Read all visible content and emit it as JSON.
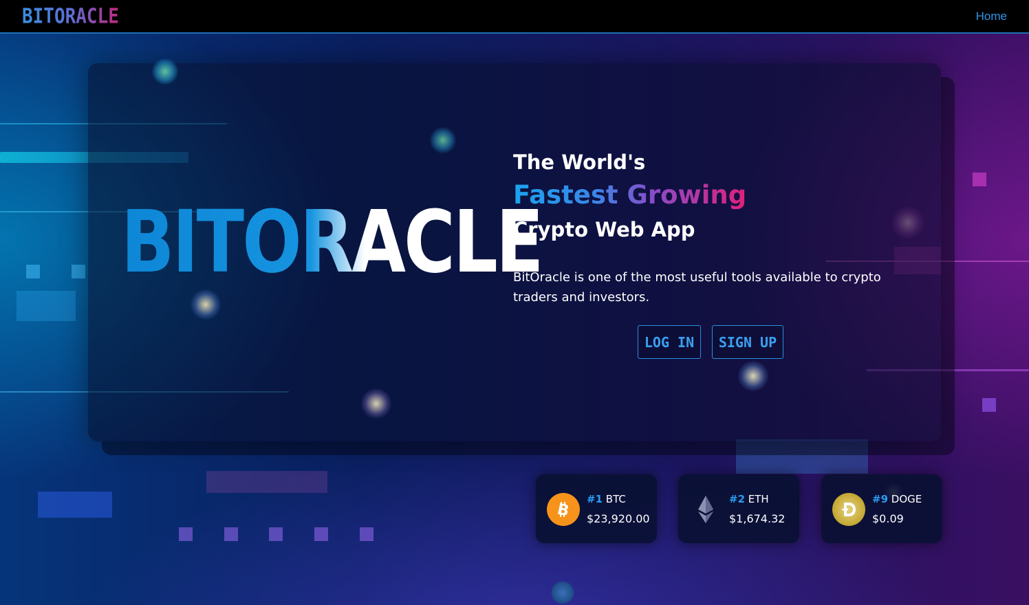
{
  "navbar": {
    "logo": "BITORACLE",
    "home_link": "Home"
  },
  "hero": {
    "big_logo": "BITORACLE",
    "headline_line1": "The World's",
    "headline_line2": "Fastest Growing",
    "headline_line3": "Crypto Web App",
    "description": "BitOracle is one of the most useful tools available to crypto traders and investors.",
    "login_label": "LOG IN",
    "signup_label": "SIGN UP"
  },
  "tickers": [
    {
      "rank": "#1",
      "symbol": "BTC",
      "price": "$23,920.00",
      "icon": "bitcoin-icon",
      "color": "#f7931a"
    },
    {
      "rank": "#2",
      "symbol": "ETH",
      "price": "$1,674.32",
      "icon": "ethereum-icon",
      "color": "#8a92b2"
    },
    {
      "rank": "#9",
      "symbol": "DOGE",
      "price": "$0.09",
      "icon": "dogecoin-icon",
      "color": "#c2a633"
    }
  ],
  "colors": {
    "accent_blue": "#2a9df0",
    "accent_pink": "#e0207a",
    "navbar_border": "#1e6fb8"
  }
}
